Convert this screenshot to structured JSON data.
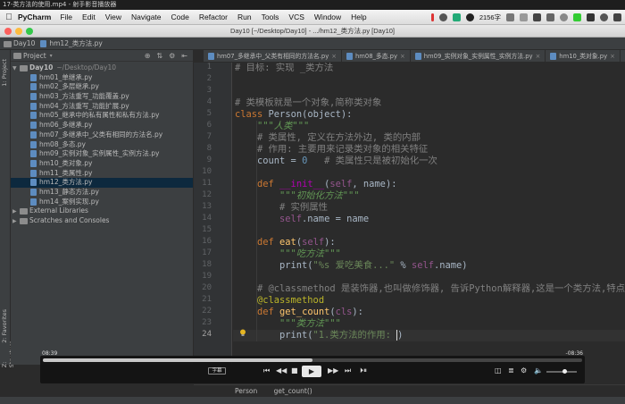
{
  "player_title": "17-类方法的使用.mp4 - 射手影音播放器",
  "menubar": {
    "app": "PyCharm",
    "items": [
      "File",
      "Edit",
      "View",
      "Navigate",
      "Code",
      "Refactor",
      "Run",
      "Tools",
      "VCS",
      "Window",
      "Help"
    ],
    "chars": "2156字"
  },
  "window_title": "Day10 [~/Desktop/Day10] - .../hm12_类方法.py [Day10]",
  "nav": {
    "folder": "Day10",
    "file": "hm12_类方法.py"
  },
  "sidebar": {
    "project_tab": "1: Project",
    "favorites_tab": "2: Favorites",
    "structure_tab": "Z: Structure"
  },
  "project": {
    "header": "Project",
    "root": "Day10",
    "root_path": "~/Desktop/Day10",
    "files": [
      "hm01_单继承.py",
      "hm02_多层继承.py",
      "hm03_方法重写_功能覆盖.py",
      "hm04_方法重写_功能扩展.py",
      "hm05_继承中的私有属性和私有方法.py",
      "hm06_多继承.py",
      "hm07_多继承中_父类有相同的方法名.py",
      "hm08_多态.py",
      "hm09_实例对象_实例属性_实例方法.py",
      "hm10_类对象.py",
      "hm11_类属性.py",
      "hm12_类方法.py",
      "hm13_静态方法.py",
      "hm14_案例实现.py"
    ],
    "selected_index": 11,
    "external": "External Libraries",
    "scratches": "Scratches and Consoles"
  },
  "tabs": [
    {
      "label": "hm07_多继承中_父类有相同的方法名.py",
      "active": false
    },
    {
      "label": "hm08_多态.py",
      "active": false
    },
    {
      "label": "hm09_实例对象_实例属性_实例方法.py",
      "active": false
    },
    {
      "label": "hm10_类对象.py",
      "active": false
    },
    {
      "label": "hm11_类属性.py",
      "active": false
    }
  ],
  "editor": {
    "line_numbers": [
      "1",
      "2",
      "3",
      "4",
      "5",
      "6",
      "7",
      "8",
      "9",
      "10",
      "11",
      "12",
      "13",
      "14",
      "15",
      "16",
      "17",
      "18",
      "19",
      "20",
      "21",
      "22",
      "23",
      "24"
    ],
    "current_line": "24",
    "code": {
      "l1": "# 目标: 实现 _类方法",
      "l4": "# 类模板就是一个对象,简称类对象",
      "l5_kw": "class",
      "l5_name": "Person",
      "l5_base": "object",
      "l6": "\"\"\"人类\"\"\"",
      "l7": "# 类属性, 定义在方法外边, 类的内部",
      "l8": "# 作用: 主要用来记录类对象的相关特征",
      "l9_name": "count",
      "l9_val": "0",
      "l9_cm": "# 类属性只是被初始化一次",
      "l11_name": "__init__",
      "l11_params": "name",
      "l12": "\"\"\"初始化方法\"\"\"",
      "l13": "# 实例属性",
      "l14_attr": "name",
      "l14_val": "name",
      "l16_name": "eat",
      "l17": "\"\"\"吃方法\"\"\"",
      "l18_fn": "print",
      "l18_str": "\"%s 爱吃美食...\"",
      "l18_attr": "name",
      "l20": "# @classmethod 是装饰器,也叫做修饰器, 告诉Python解释器,这是一个类方法,特点",
      "l21": "@classmethod",
      "l22_name": "get_count",
      "l22_params": "cls",
      "l23": "\"\"\"类方法\"\"\"",
      "l24_fn": "print",
      "l24_str": "\"1.类方法的作用: "
    }
  },
  "player": {
    "time_left": "08:39",
    "time_right": "-08:36",
    "progress": 0.5,
    "subtitle_label": "字幕"
  },
  "breadcrumb": [
    "Person",
    "get_count()"
  ],
  "colors": {
    "background": "#2b2b2b",
    "keyword": "#cc7832",
    "string": "#6a8759",
    "comment": "#808080",
    "selection": "#0d293e"
  }
}
